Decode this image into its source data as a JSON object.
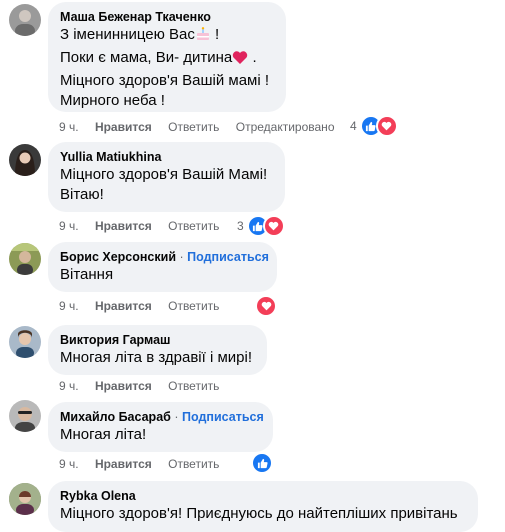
{
  "colors": {
    "bubble": "#f0f2f5",
    "link": "#216fdb",
    "meta": "#65676b",
    "like": "#1877f2",
    "love": "#f33e58"
  },
  "comments": [
    {
      "author": "Маша Беженар Ткаченко",
      "lines": [
        "З іменинницею Вас",
        "Поки є мама, Ви- дитина",
        ".",
        "Міцного здоров'я Вашій мамі !",
        "Мирного неба !"
      ],
      "emoji": {
        "line1": "birthday-cake-icon",
        "line2": "red-heart-icon"
      },
      "time": "9 ч.",
      "like": "Нравится",
      "reply": "Ответить",
      "edited": "Отредактировано",
      "reaction_count": "4"
    },
    {
      "author": "Yullia Matiukhina",
      "lines": [
        "Міцного здоров'я Вашій Мамі!",
        "Вітаю!"
      ],
      "time": "9 ч.",
      "like": "Нравится",
      "reply": "Ответить",
      "reaction_count": "3"
    },
    {
      "author": "Борис Херсонский",
      "separator": "·",
      "subscribe": "Подписаться",
      "lines": [
        "Вітання"
      ],
      "time": "9 ч.",
      "like": "Нравится",
      "reply": "Ответить"
    },
    {
      "author": "Виктория Гармаш",
      "lines": [
        "Многая літа в здравії і мирі!"
      ],
      "time": "9 ч.",
      "like": "Нравится",
      "reply": "Ответить"
    },
    {
      "author": "Михайло Басараб",
      "separator": "·",
      "subscribe": "Подписаться",
      "lines": [
        "Многая літа!"
      ],
      "time": "9 ч.",
      "like": "Нравится",
      "reply": "Ответить"
    },
    {
      "author": "Rybka Olena",
      "lines": [
        "Міцного здоров'я! Приєднуюсь до найтепліших привітань"
      ]
    }
  ]
}
